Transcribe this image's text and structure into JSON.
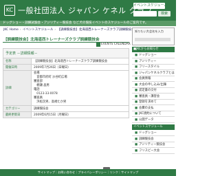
{
  "header": {
    "logo_mark": "KC",
    "site_title": "一般社団法人 ジャパン ケネル クラブ",
    "schedule_button": "イベントスケジュール",
    "search_go": "検索"
  },
  "tagline": "ドッグショー・訓練試験会・アジリティー競技会 など犬の競技イベントのスケジュールのご案内です。",
  "breadcrumb": [
    "JKC Home",
    "イベントスケジュール",
    "【訓練競技会】北海道西トレーナーズクラブ訓練競技会"
  ],
  "event": {
    "title": "【訓練競技会】北海道西トレーナーズクラブ訓練競技会",
    "calendar_label": "EVENTS CALENDAR"
  },
  "table": {
    "caption": "予定表 －詳細情報－",
    "rows": [
      {
        "label": "名称",
        "value": "【訓練競技会】北海道西トレーナーズクラブ訓練競技会"
      },
      {
        "label": "開催日時",
        "value": "2009年7月26日（日曜日）"
      }
    ],
    "detail_label": "詳細",
    "detail_lines": [
      "会場",
      "　首都市府町 沙谷町広場",
      "審査部",
      "　棚瀬 晶男",
      "電話",
      "　0123-33-0078",
      "審査員",
      "　浜松次男、高崎たか男"
    ],
    "footer_rows": [
      {
        "label": "カテゴリー",
        "value": "訓練競技会"
      },
      {
        "label": "最終更新日",
        "value": "2009年6月15日（月曜日）"
      }
    ]
  },
  "sidebar": {
    "search_label": "知りたい大会名を入力",
    "sections": [
      {
        "head": "■JKCからお知らせ",
        "items": [
          "ドッグショー",
          "アジリティー",
          "フリースタイル",
          "ジャパンケネルクラブとは",
          "会員情報",
          "大会の申し込み/出陳",
          "認定書の交付",
          "審査員・講習会",
          "登録を求めて",
          "会費の支払",
          "JKC規約について",
          "公開データ"
        ]
      },
      {
        "head": "イベントスケジュール",
        "items": [
          "ドッグショー",
          "訓練競技会",
          "アジリティー競技会",
          "フリスビー大会"
        ]
      }
    ]
  },
  "footer_text": "サイトマップ｜お問い合わせ｜プライバシーポリシー｜リンク｜サイトマップ"
}
